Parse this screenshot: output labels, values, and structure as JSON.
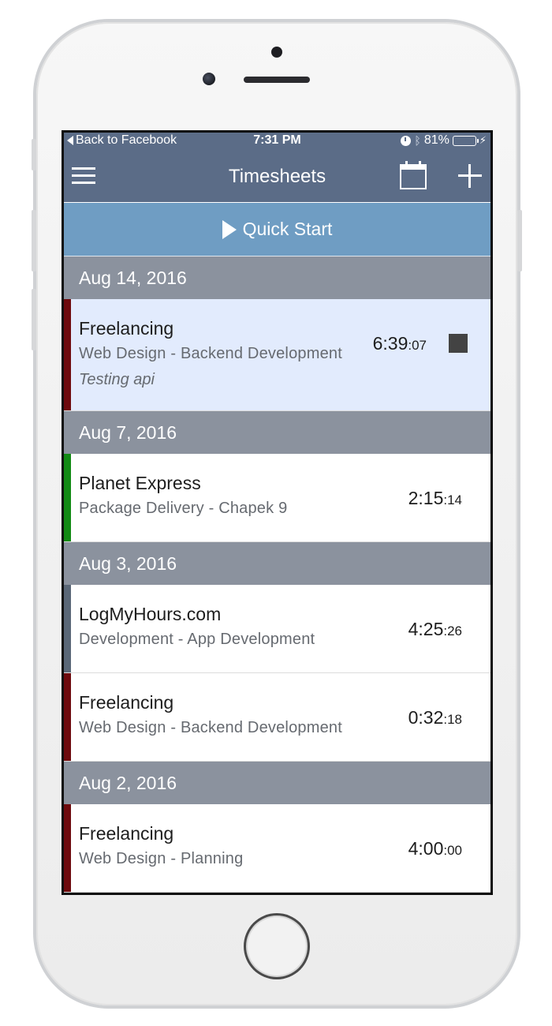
{
  "status_bar": {
    "back_label": "Back to Facebook",
    "time": "7:31 PM",
    "battery": "81%",
    "battery_level": 0.81
  },
  "nav": {
    "title": "Timesheets",
    "menu_icon": "hamburger-menu-icon",
    "calendar_icon": "calendar-icon",
    "add_icon": "plus-icon"
  },
  "quick_start": {
    "label": "Quick Start",
    "icon": "play-icon"
  },
  "groups": [
    {
      "date": "Aug 14, 2016",
      "entries": [
        {
          "client": "Freelancing",
          "project": "Web Design - Backend Development",
          "note": "Testing api",
          "duration_main": "6:39",
          "duration_sec": ":07",
          "color": "#6e0a0e",
          "running": true
        }
      ]
    },
    {
      "date": "Aug 7, 2016",
      "entries": [
        {
          "client": "Planet Express",
          "project": "Package Delivery - Chapek 9",
          "duration_main": "2:15",
          "duration_sec": ":14",
          "color": "#128a14"
        }
      ]
    },
    {
      "date": "Aug 3, 2016",
      "entries": [
        {
          "client": "LogMyHours.com",
          "project": "Development - App Development",
          "duration_main": "4:25",
          "duration_sec": ":26",
          "color": "#5a6777"
        },
        {
          "client": "Freelancing",
          "project": "Web Design - Backend Development",
          "duration_main": "0:32",
          "duration_sec": ":18",
          "color": "#6e0a0e"
        }
      ]
    },
    {
      "date": "Aug 2, 2016",
      "entries": [
        {
          "client": "Freelancing",
          "project": "Web Design - Planning",
          "duration_main": "4:00",
          "duration_sec": ":00",
          "color": "#6e0a0e"
        }
      ]
    }
  ],
  "colors": {
    "nav_bg": "#5b6c87",
    "quick_start_bg": "#6f9dc3",
    "date_header_bg": "#8b929e",
    "active_row_bg": "#e2ebfd"
  }
}
